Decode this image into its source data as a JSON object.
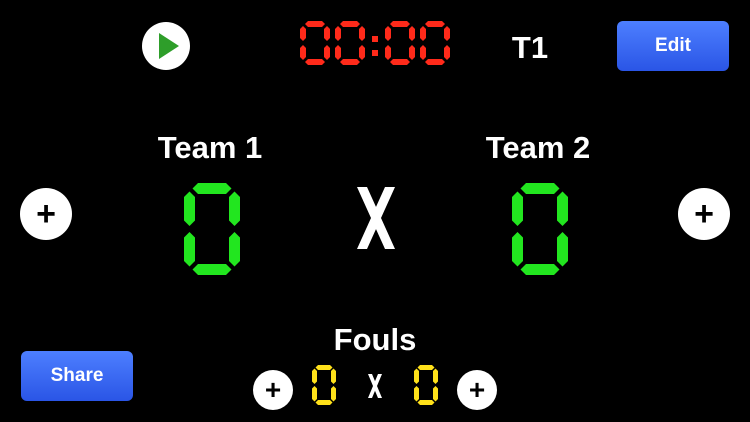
{
  "timer": {
    "display": "00:00",
    "minutes": "00",
    "seconds": "00",
    "color": "#ff2a1a"
  },
  "period": "T1",
  "toolbar": {
    "edit_label": "Edit",
    "share_label": "Share"
  },
  "teams": [
    {
      "name": "Team 1",
      "score": "0",
      "fouls": "0"
    },
    {
      "name": "Team 2",
      "score": "0",
      "fouls": "0"
    }
  ],
  "separator": "X",
  "fouls": {
    "label": "Fouls"
  },
  "icons": {
    "play": "play-icon",
    "plus": "plus-icon"
  },
  "colors": {
    "background": "#000000",
    "score": "#22e61f",
    "fouls": "#ffe11a",
    "button": "#3466f0"
  }
}
